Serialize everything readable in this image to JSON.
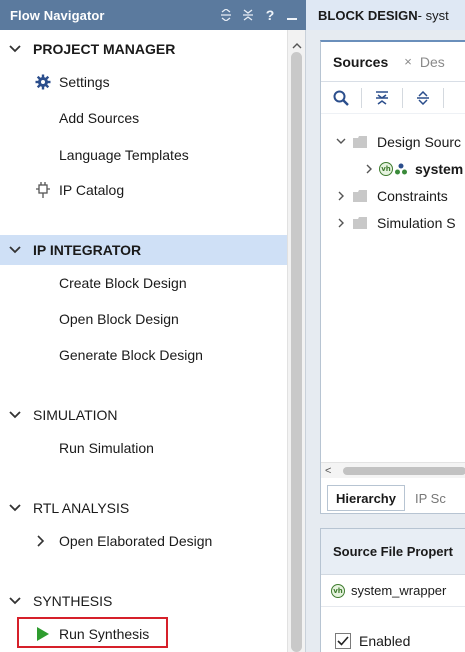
{
  "flow_navigator": {
    "title": "Flow Navigator",
    "tools": {
      "expand_all": "expand-all-icon",
      "collapse_all": "collapse-all-icon",
      "help": "?",
      "minimize": "minimize-icon"
    },
    "sections": [
      {
        "label": "PROJECT MANAGER",
        "items": [
          "Settings",
          "Add Sources",
          "Language Templates",
          "IP Catalog"
        ]
      },
      {
        "label": "IP INTEGRATOR",
        "items": [
          "Create Block Design",
          "Open Block Design",
          "Generate Block Design"
        ]
      },
      {
        "label": "SIMULATION",
        "items": [
          "Run Simulation"
        ]
      },
      {
        "label": "RTL ANALYSIS",
        "items": [
          "Open Elaborated Design"
        ]
      },
      {
        "label": "SYNTHESIS",
        "items": [
          "Run Synthesis"
        ]
      }
    ],
    "selected_section": "IP INTEGRATOR",
    "highlighted_item": "Run Synthesis"
  },
  "block_design": {
    "header_bold": "BLOCK DESIGN",
    "header_rest": " - syst"
  },
  "sources": {
    "tab_active": "Sources",
    "tab_close": "×",
    "tab_next": "Des",
    "tree": [
      "Design Sourc",
      "system",
      "Constraints",
      "Simulation S"
    ],
    "bottom_tabs": [
      "Hierarchy",
      "IP Sc"
    ]
  },
  "properties": {
    "title": "Source File Propert",
    "file": "system_wrapper",
    "file_badge": "vh",
    "enabled_label": "Enabled",
    "enabled": true
  },
  "colors": {
    "accent": "#5b7a9e",
    "selection": "#cfe0f6",
    "highlight": "#d6202a",
    "run": "#2e9c2e"
  }
}
